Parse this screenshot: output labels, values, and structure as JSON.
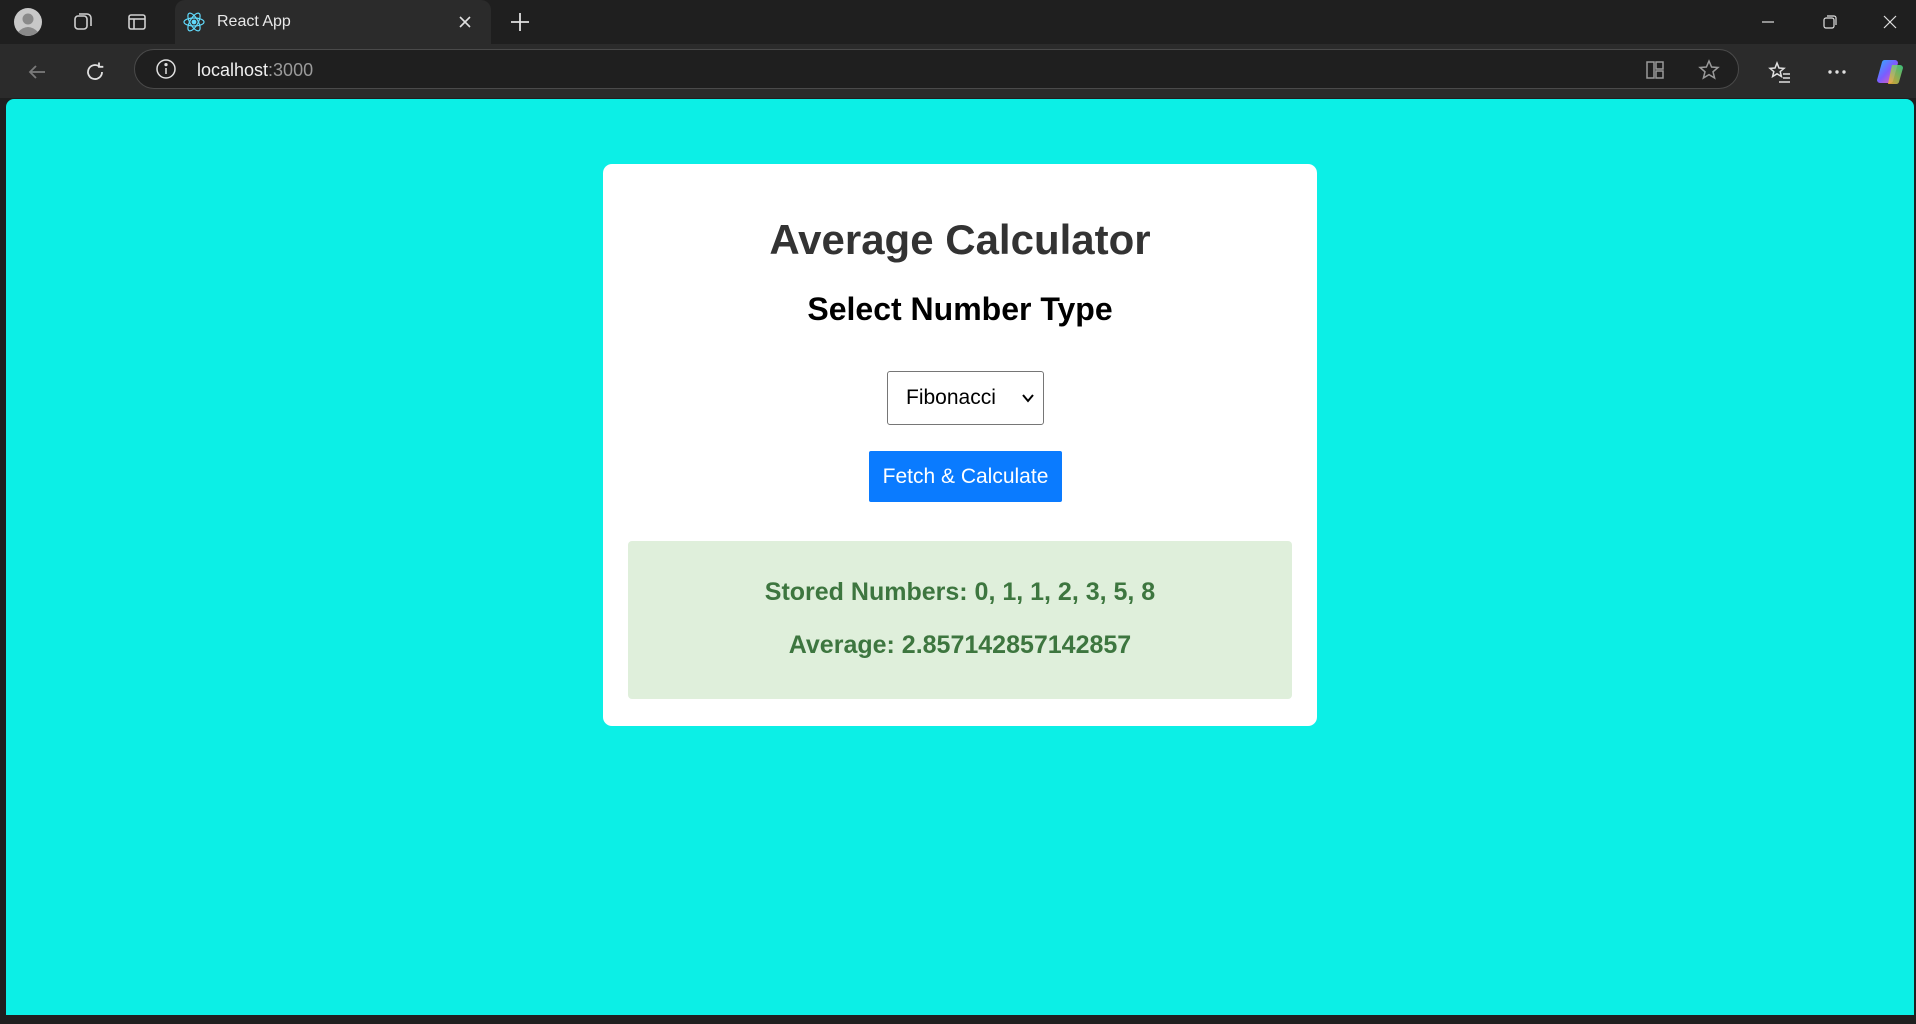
{
  "browser": {
    "tab_title": "React App",
    "url_host": "localhost",
    "url_port": ":3000"
  },
  "page": {
    "background_color": "#0cefe6",
    "title": "Average Calculator",
    "subtitle": "Select Number Type",
    "select": {
      "selected": "Fibonacci"
    },
    "button_label": "Fetch & Calculate",
    "button_color": "#0a7bff",
    "result": {
      "stored_numbers": "Stored Numbers: 0, 1, 1, 2, 3, 5, 8",
      "average": "Average: 2.857142857142857"
    }
  }
}
